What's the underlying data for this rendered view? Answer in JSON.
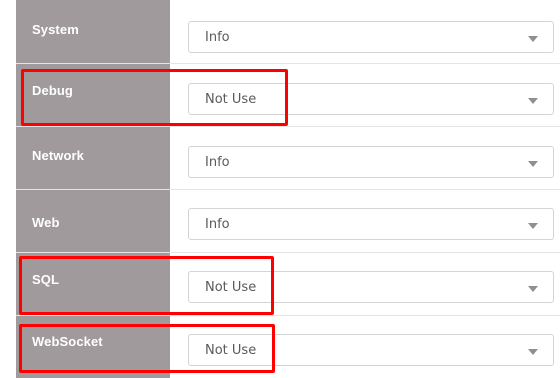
{
  "log_levels": [
    {
      "name": "System",
      "value": "Info"
    },
    {
      "name": "Debug",
      "value": "Not Use"
    },
    {
      "name": "Network",
      "value": "Info"
    },
    {
      "name": "Web",
      "value": "Info"
    },
    {
      "name": "SQL",
      "value": "Not Use"
    },
    {
      "name": "WebSocket",
      "value": "Not Use"
    }
  ],
  "colors": {
    "label_background": "#a09a9d",
    "highlight": "#ff0000",
    "select_border": "#d6d3d4",
    "chevron": "#8f8f8f"
  },
  "icons": {
    "dropdown": "chevron-down-icon"
  }
}
